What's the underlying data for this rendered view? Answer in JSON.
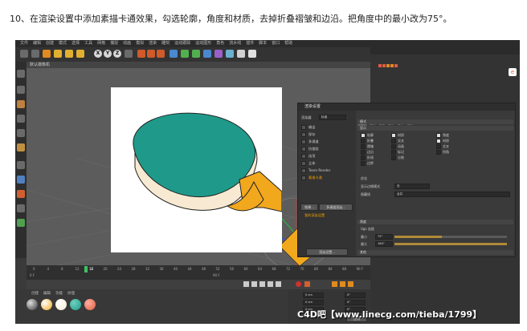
{
  "caption": "10、在渲染设置中添加素描卡通效果，勾选轮廓，角度和材质，去掉折叠褶皱和边沿。把角度中的最小改为75°。",
  "watermark": "C4D吧【www.linecg.com/tieba/1799】",
  "app": {
    "menu_items": [
      "文件",
      "编辑",
      "创建",
      "模式",
      "选择",
      "工具",
      "网格",
      "捕捉",
      "动画",
      "模拟",
      "渲染",
      "雕刻",
      "运动跟踪",
      "运动图形",
      "角色",
      "流水线",
      "插件",
      "脚本",
      "窗口",
      "帮助"
    ],
    "toolbar_axes": [
      "X",
      "Y",
      "Z"
    ],
    "viewport_label": "默认摄像机",
    "timeline_ticks": [
      "0",
      "4",
      "8",
      "12",
      "16",
      "20",
      "24",
      "28",
      "32",
      "36",
      "40",
      "44",
      "48",
      "52",
      "56",
      "60",
      "64",
      "68",
      "72",
      "76",
      "80",
      "84",
      "88",
      "90 F"
    ],
    "timeline_current": "12",
    "frame_start": "0 F",
    "frame_end": "90 F",
    "grid_label": "网格间距：100 cm",
    "materials_menu": [
      "创建",
      "编辑",
      "功能",
      "纹理"
    ],
    "coord_values": [
      "0 cm",
      "0 cm",
      "0 cm",
      "0°",
      "0°",
      "0°"
    ],
    "apply_button": "应用"
  },
  "dialog": {
    "title": "渲染设置",
    "renderer_label": "渲染器",
    "renderer_value": "标准",
    "left_items": [
      "输出",
      "保存",
      "多通道",
      "抗锯齿",
      "选项",
      "立体",
      "Team Render",
      "素描卡通"
    ],
    "active_item": "素描卡通",
    "effect_button": "效果...",
    "multipass_button": "多通道渲染...",
    "my_settings": "我的渲染设置",
    "render_setting_button": "渲染设置...",
    "tabs": [
      "线条",
      "渲染",
      "着色",
      "显示",
      "基本",
      "图示"
    ],
    "active_tab": "线条",
    "section_mode": "模式",
    "section_main": "显示",
    "checks_col1": [
      "轮廓",
      "折叠",
      "褶皱",
      "边沿",
      "折线",
      "边界",
      "材质",
      "交叉",
      "动画",
      "标记",
      "分割"
    ],
    "checks_col1_state": [
      true,
      false,
      false,
      false,
      false,
      false,
      true,
      false,
      false,
      false,
      false
    ],
    "checks_col2": [
      "角度",
      "材质",
      "交叉",
      "拐角"
    ],
    "checks_col2_state": [
      true,
      true,
      false,
      false
    ],
    "filter_label": "优化",
    "edge_label": "显示边缘模式",
    "edge_value": "无",
    "hidden_label": "隐藏线",
    "hidden_value": "合并",
    "section_angle": "角度",
    "angle_sub": "Ugs 连接",
    "angle_min_label": "最小",
    "angle_min_value": "75°",
    "angle_max_label": "最大",
    "angle_max_value": "180°",
    "angle_min_fill": 0.42,
    "angle_max_fill": 1.0,
    "section_other": "其他"
  },
  "colors": {
    "paddle_face": "#1f9a8a",
    "paddle_side": "#f8ead2",
    "paddle_handle": "#f2a81d",
    "accent_orange": "#f0a000",
    "ui_dark": "#3a3a3a"
  }
}
